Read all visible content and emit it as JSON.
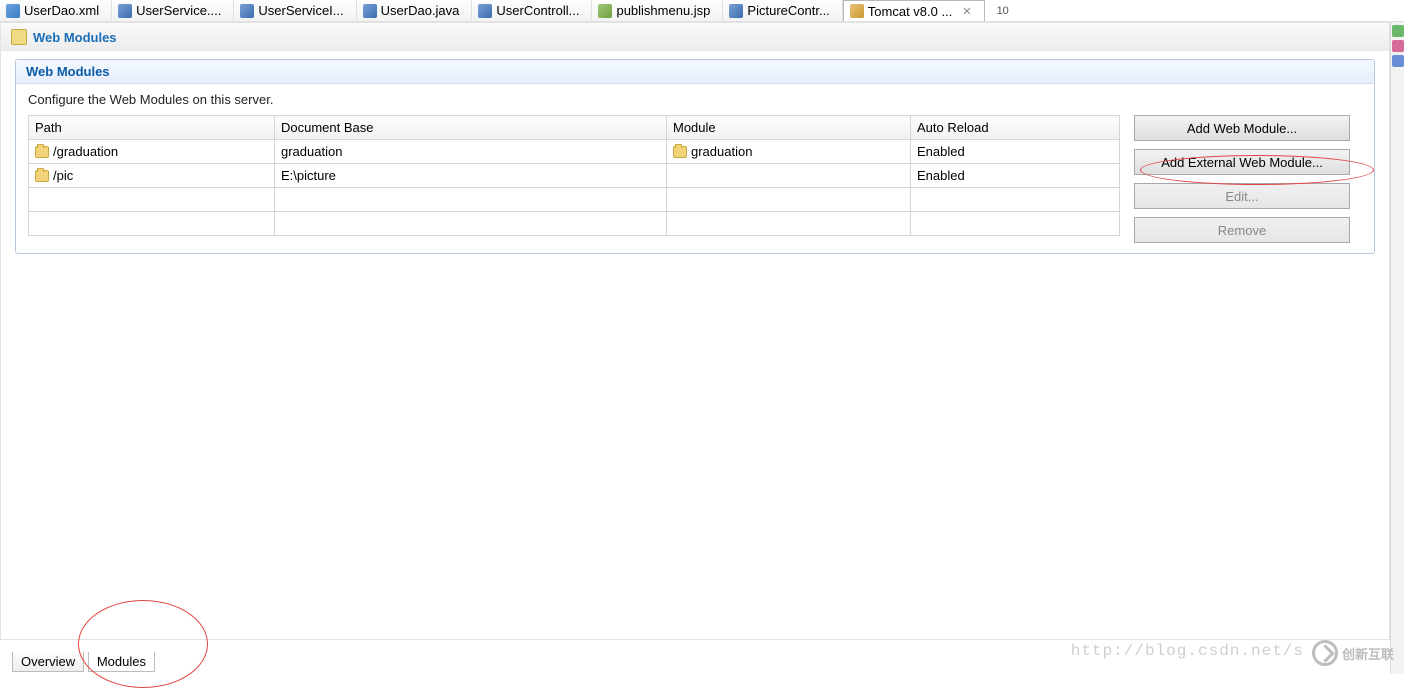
{
  "tabs": [
    {
      "label": "UserDao.xml",
      "icon": "xml"
    },
    {
      "label": "UserService....",
      "icon": "j"
    },
    {
      "label": "UserServiceI...",
      "icon": "j"
    },
    {
      "label": "UserDao.java",
      "icon": "j"
    },
    {
      "label": "UserControll...",
      "icon": "j"
    },
    {
      "label": "publishmenu.jsp",
      "icon": "jsp"
    },
    {
      "label": "PictureContr...",
      "icon": "j"
    },
    {
      "label": "Tomcat v8.0 ...",
      "icon": "tomcat",
      "active": true,
      "closable": true
    }
  ],
  "counter": "10",
  "section_title": "Web Modules",
  "panel": {
    "header": "Web Modules",
    "desc": "Configure the Web Modules on this server.",
    "columns": [
      "Path",
      "Document Base",
      "Module",
      "Auto Reload"
    ],
    "rows": [
      {
        "path": "/graduation",
        "docbase": "graduation",
        "module": "graduation",
        "auto": "Enabled",
        "mod_icon": true
      },
      {
        "path": "/pic",
        "docbase": "E:\\picture",
        "module": "",
        "auto": "Enabled",
        "mod_icon": false
      }
    ],
    "blank_rows": 2
  },
  "buttons": {
    "add": "Add Web Module...",
    "add_ext": "Add External Web Module...",
    "edit": "Edit...",
    "remove": "Remove"
  },
  "bottom_tabs": {
    "overview": "Overview",
    "modules": "Modules"
  },
  "watermark": "http://blog.csdn.net/s",
  "logo_text": "创新互联"
}
